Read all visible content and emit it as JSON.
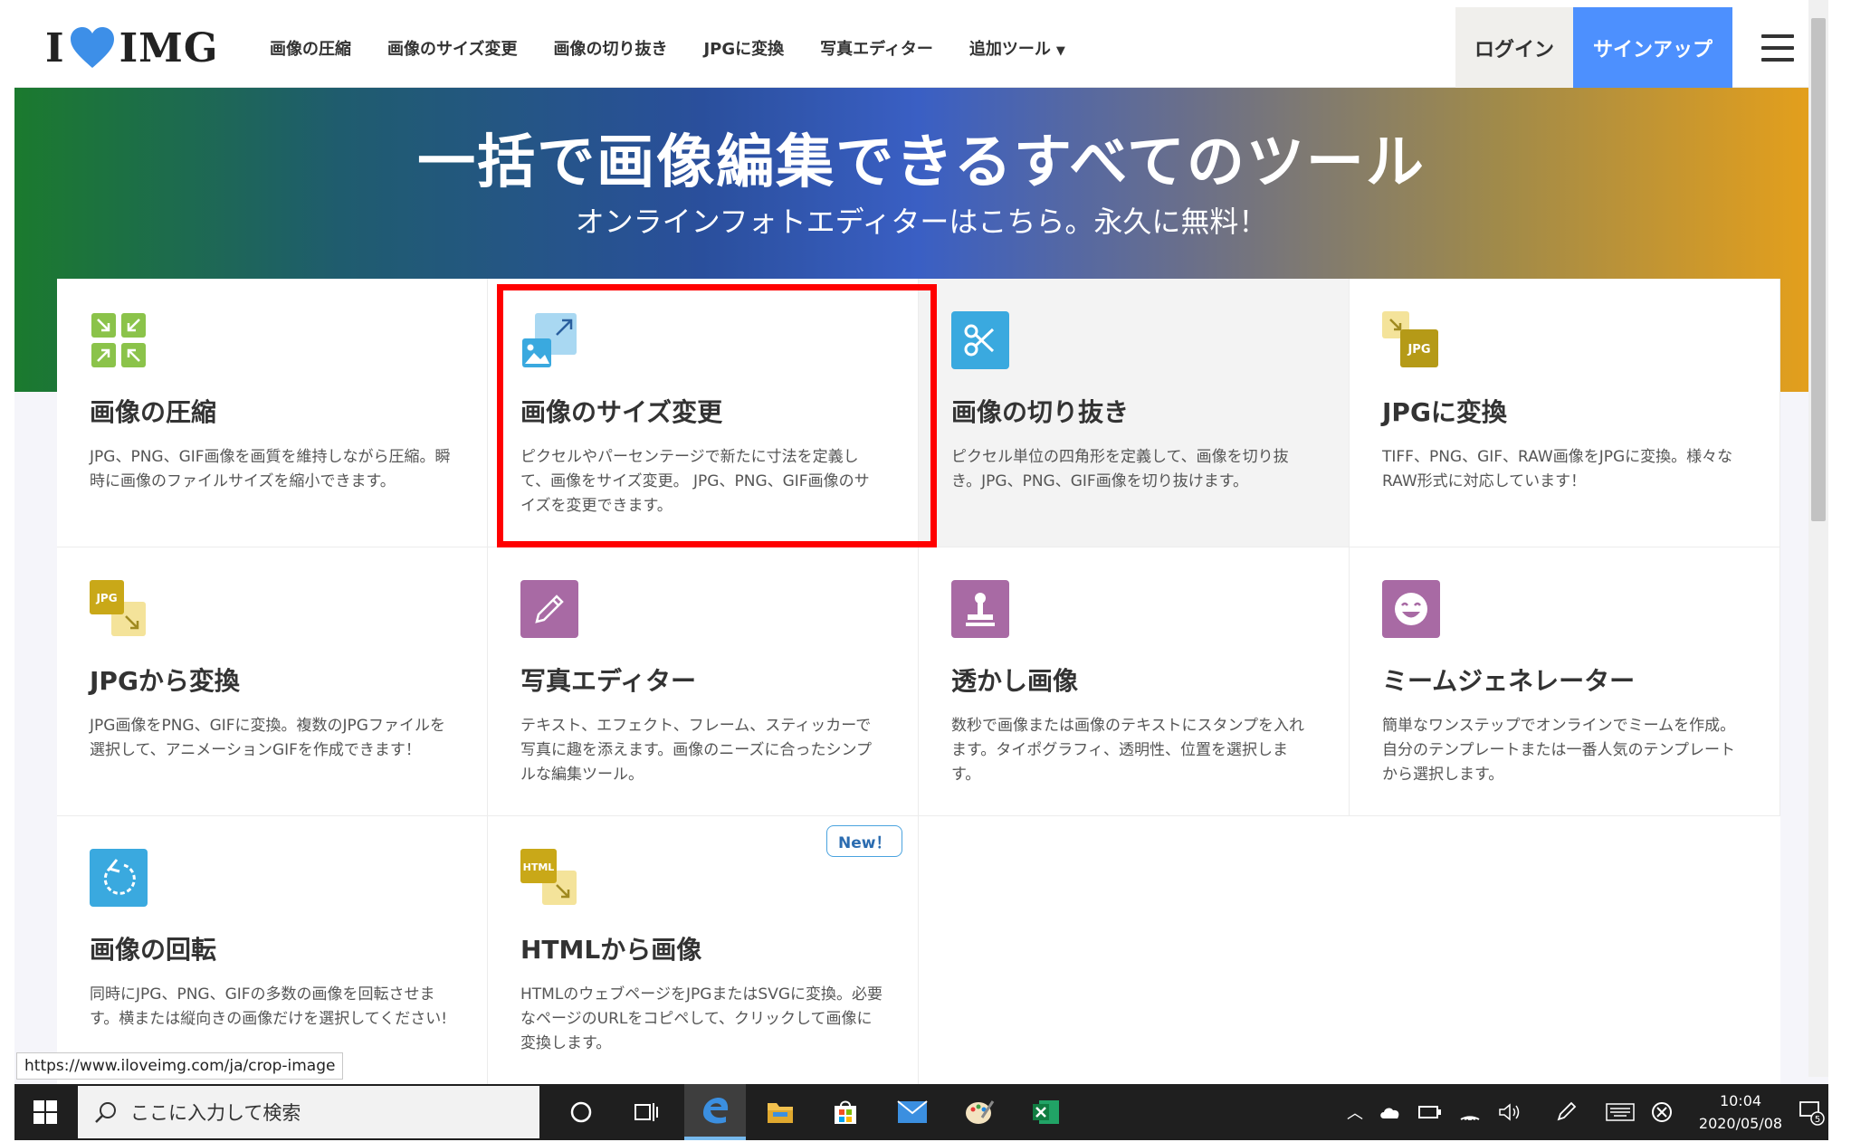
{
  "nav": {
    "logo_left": "I",
    "logo_right": "IMG",
    "links": [
      "画像の圧縮",
      "画像のサイズ変更",
      "画像の切り抜き",
      "JPGに変換",
      "写真エディター",
      "追加ツール"
    ],
    "more_caret": "▼",
    "login": "ログイン",
    "signup": "サインアップ"
  },
  "hero": {
    "title": "一括で画像編集できるすべてのツール",
    "subtitle": "オンラインフォトエディターはこちら。永久に無料！"
  },
  "tools": [
    {
      "title": "画像の圧縮",
      "desc": "JPG、PNG、GIF画像を画質を維持しながら圧縮。瞬時に画像のファイルサイズを縮小できます。",
      "icon": "compress-icon"
    },
    {
      "title": "画像のサイズ変更",
      "desc": "ピクセルやパーセンテージで新たに寸法を定義して、画像をサイズ変更。 JPG、PNG、GIF画像のサイズを変更できます。",
      "icon": "resize-icon"
    },
    {
      "title": "画像の切り抜き",
      "desc": "ピクセル単位の四角形を定義して、画像を切り抜き。JPG、PNG、GIF画像を切り抜けます。",
      "icon": "scissors-icon"
    },
    {
      "title": "JPGに変換",
      "desc": "TIFF、PNG、GIF、RAW画像をJPGに変換。様々なRAW形式に対応しています！",
      "icon": "convert-to-jpg-icon",
      "icon_label": "JPG"
    },
    {
      "title": "JPGから変換",
      "desc": "JPG画像をPNG、GIFに変換。複数のJPGファイルを選択して、アニメーションGIFを作成できます！",
      "icon": "convert-from-jpg-icon",
      "icon_label": "JPG"
    },
    {
      "title": "写真エディター",
      "desc": "テキスト、エフェクト、フレーム、スティッカーで写真に趣を添えます。画像のニーズに合ったシンプルな編集ツール。",
      "icon": "pencil-icon"
    },
    {
      "title": "透かし画像",
      "desc": "数秒で画像または画像のテキストにスタンプを入れます。タイポグラフィ、透明性、位置を選択します。",
      "icon": "stamp-icon"
    },
    {
      "title": "ミームジェネレーター",
      "desc": "簡単なワンステップでオンラインでミームを作成。自分のテンプレートまたは一番人気のテンプレートから選択します。",
      "icon": "smiley-icon"
    },
    {
      "title": "画像の回転",
      "desc": "同時にJPG、PNG、GIFの多数の画像を回転させます。横または縦向きの画像だけを選択してください!",
      "icon": "rotate-icon"
    },
    {
      "title": "HTMLから画像",
      "desc": "HTMLのウェブページをJPGまたはSVGに変換。必要なページのURLをコピペして、クリックして画像に変換します。",
      "icon": "html-to-image-icon",
      "icon_label": "HTML",
      "badge": "New！"
    }
  ],
  "status_url": "https://www.iloveimg.com/ja/crop-image",
  "taskbar": {
    "search_placeholder": "ここに入力して検索",
    "time": "10:04",
    "date": "2020/05/08",
    "notification_count": "5"
  },
  "colors": {
    "signup_bg": "#4d90fe",
    "highlight": "#ff0000",
    "green_icon": "#8bc34a",
    "blue_icon": "#4fb3e8",
    "teal_icon": "#3aa9df",
    "purple_icon": "#a86aa4",
    "yellow_icon": "#e8c84a"
  }
}
